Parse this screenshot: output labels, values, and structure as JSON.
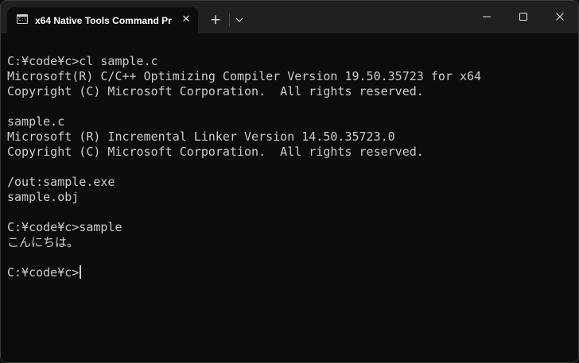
{
  "window": {
    "tab_title": "x64 Native Tools Command Pr",
    "tab_icon_glyph": "C:\\",
    "close_tab_glyph": "✕",
    "new_tab_glyph": "+"
  },
  "terminal": {
    "lines": [
      "C:¥code¥c>cl sample.c",
      "Microsoft(R) C/C++ Optimizing Compiler Version 19.50.35723 for x64",
      "Copyright (C) Microsoft Corporation.  All rights reserved.",
      "",
      "sample.c",
      "Microsoft (R) Incremental Linker Version 14.50.35723.0",
      "Copyright (C) Microsoft Corporation.  All rights reserved.",
      "",
      "/out:sample.exe",
      "sample.obj",
      "",
      "C:¥code¥c>sample",
      "こんにちは。",
      "",
      "C:¥code¥c>"
    ]
  },
  "colors": {
    "titlebar": "#202020",
    "terminal_bg": "#0c0c0c",
    "text": "#cccccc"
  },
  "icons": {
    "tab_icon": "command-prompt-icon",
    "close_tab": "close-icon",
    "new_tab": "plus-icon",
    "dropdown": "chevron-down-icon",
    "minimize": "minimize-icon",
    "maximize": "maximize-icon",
    "close_window": "close-icon"
  }
}
